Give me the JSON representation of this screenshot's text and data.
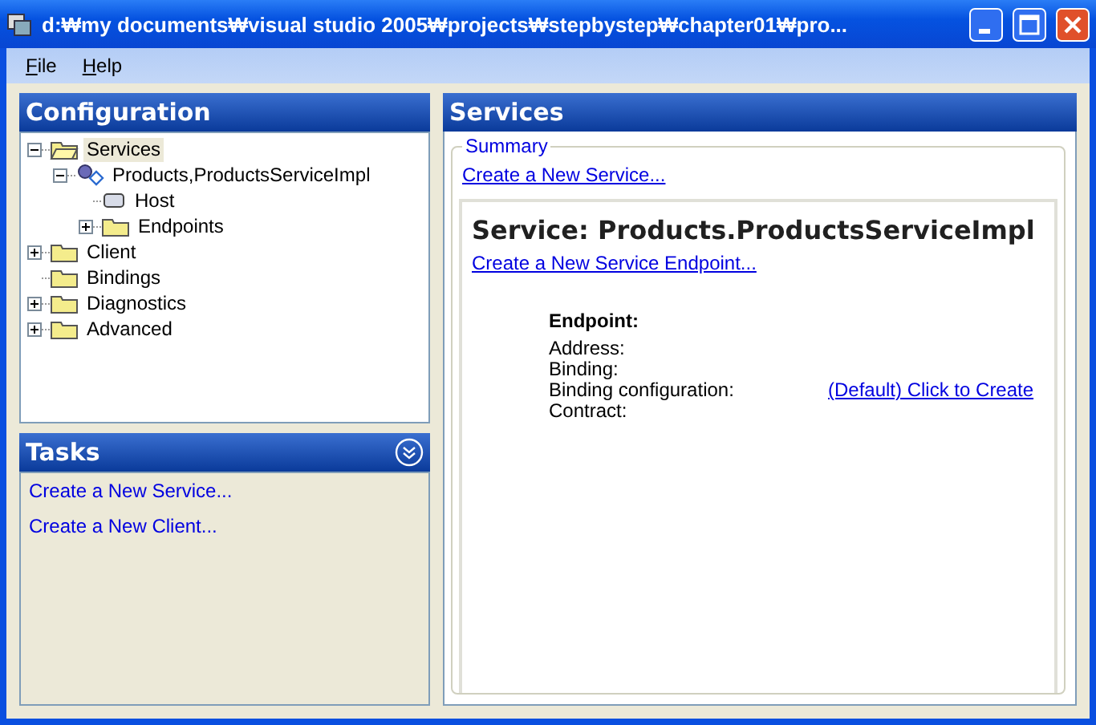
{
  "window": {
    "title": "d:₩my documents₩visual studio 2005₩projects₩stepbystep₩chapter01₩pro..."
  },
  "menu": [
    {
      "label": "File"
    },
    {
      "label": "Help"
    }
  ],
  "configuration": {
    "title": "Configuration",
    "tree": [
      {
        "label": "Services",
        "kind": "folder",
        "expanded": true,
        "selected": true,
        "children": [
          {
            "label": "Products,ProductsServiceImpl",
            "kind": "service",
            "expanded": true,
            "selected": false,
            "children": [
              {
                "label": "Host",
                "kind": "host",
                "selected": false
              },
              {
                "label": "Endpoints",
                "kind": "folder",
                "expanded": false,
                "selected": false
              }
            ]
          }
        ]
      },
      {
        "label": "Client",
        "kind": "folder",
        "expanded": false,
        "selected": false
      },
      {
        "label": "Bindings",
        "kind": "folder",
        "selected": false
      },
      {
        "label": "Diagnostics",
        "kind": "folder",
        "expanded": false,
        "selected": false
      },
      {
        "label": "Advanced",
        "kind": "folder",
        "expanded": false,
        "selected": false
      }
    ]
  },
  "tasks": {
    "title": "Tasks",
    "items": [
      "Create a New Service...",
      "Create a New Client..."
    ]
  },
  "services": {
    "title": "Services",
    "summary": {
      "legend": "Summary",
      "link": "Create a New Service..."
    },
    "service": {
      "heading": "Service: Products.ProductsServiceImpl",
      "link": "Create a New Service Endpoint...",
      "endpoint": {
        "heading": "Endpoint:",
        "fields": [
          {
            "label": "Address:"
          },
          {
            "label": "Binding:"
          },
          {
            "label": "Binding configuration:",
            "link": "(Default) Click to Create"
          },
          {
            "label": "Contract:"
          }
        ]
      }
    }
  }
}
